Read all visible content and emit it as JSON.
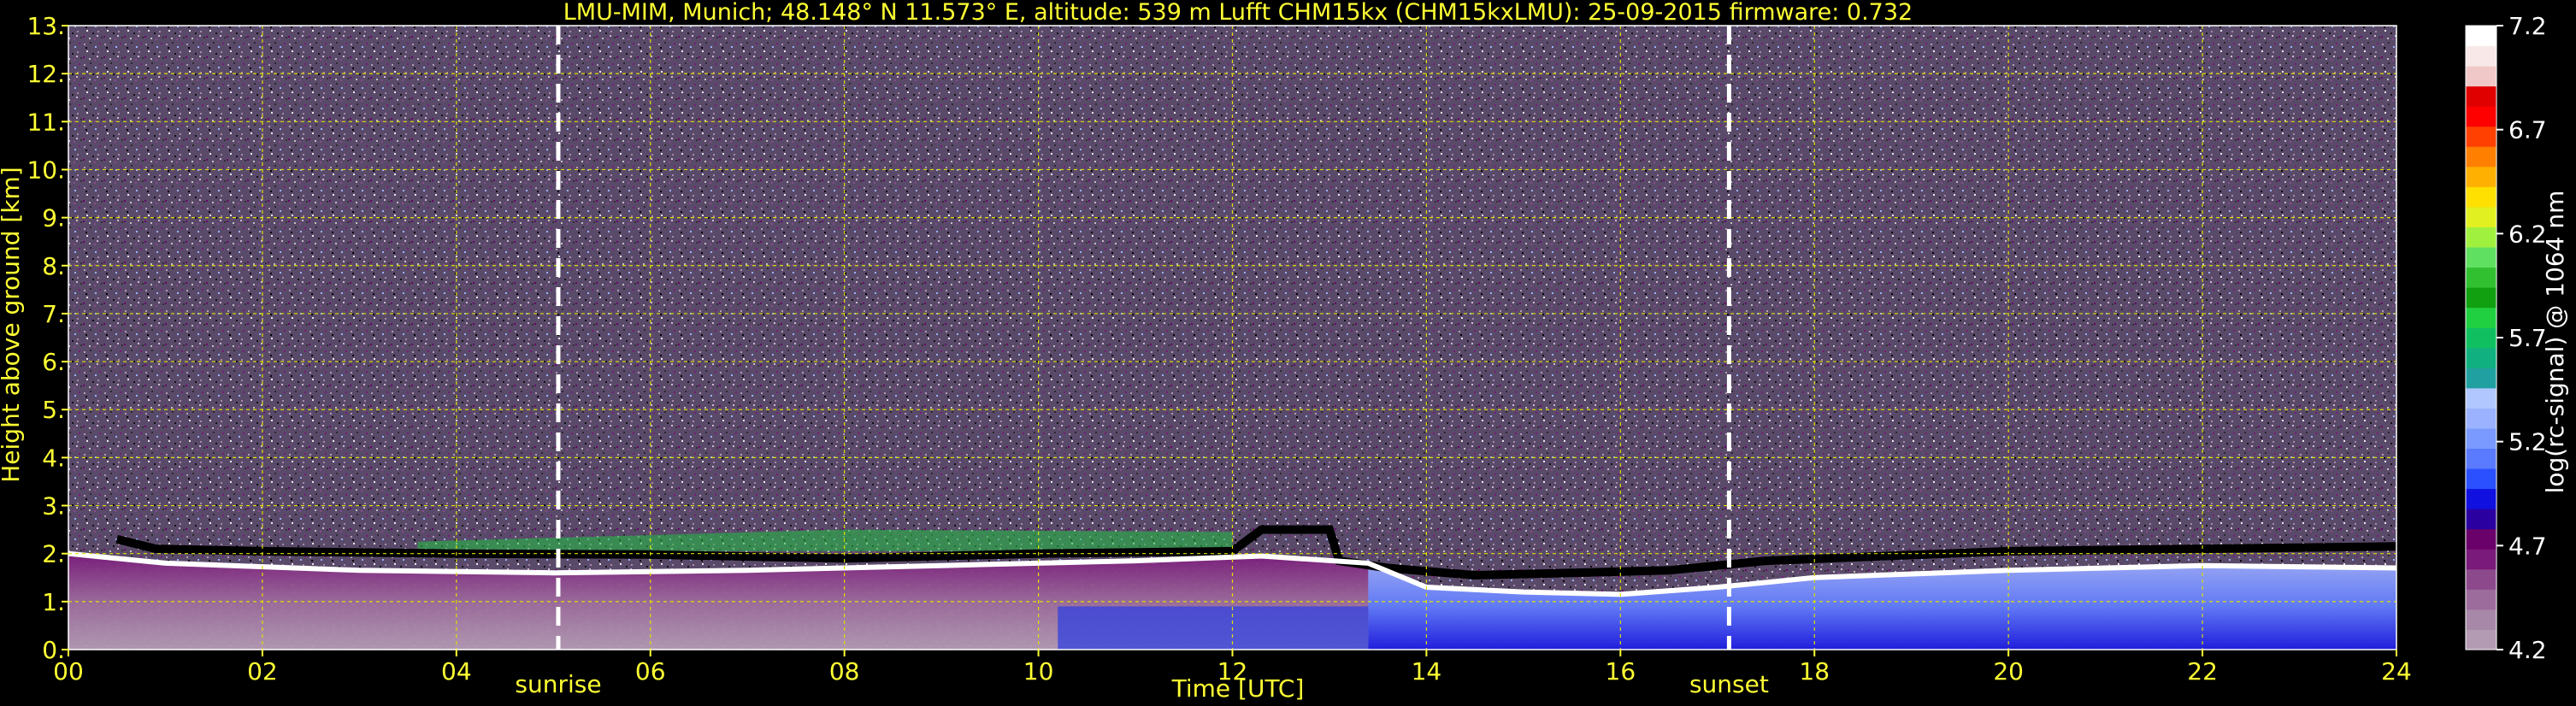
{
  "chart_data": {
    "type": "heatmap",
    "title": "LMU-MIM, Munich; 48.148° N 11.573° E, altitude: 539 m    Lufft CHM15kx (CHM15kxLMU): 25-09-2015    firmware: 0.732",
    "xlabel": "Time [UTC]",
    "ylabel": "Height above ground [km]",
    "colorbar_label": "log(rc-signal) @ 1064 nm",
    "xlim": [
      0,
      24
    ],
    "ylim": [
      0,
      13
    ],
    "x_ticks": [
      0,
      2,
      4,
      6,
      8,
      10,
      12,
      14,
      16,
      18,
      20,
      22,
      24
    ],
    "x_tick_labels": [
      "00",
      "02",
      "04",
      "06",
      "08",
      "10",
      "12",
      "14",
      "16",
      "18",
      "20",
      "22",
      "24"
    ],
    "y_ticks": [
      0,
      1,
      2,
      3,
      4,
      5,
      6,
      7,
      8,
      9,
      10,
      11,
      12,
      13
    ],
    "y_tick_labels": [
      "0.",
      "1.",
      "2.",
      "3.",
      "4.",
      "5.",
      "6.",
      "7.",
      "8.",
      "9.",
      "10.",
      "11.",
      "12.",
      "13."
    ],
    "colorbar_range": [
      4.2,
      7.2
    ],
    "colorbar_ticks": [
      4.2,
      4.7,
      5.2,
      5.7,
      6.2,
      6.7,
      7.2
    ],
    "colorbar_tick_labels": [
      "4.2",
      "4.7",
      "5.2",
      "5.7",
      "6.2",
      "6.7",
      "7.2"
    ],
    "colorbar_colors": [
      "#b49bb4",
      "#a888a8",
      "#9c6c9c",
      "#8c4a8c",
      "#7a1a7a",
      "#6a006a",
      "#2a00a0",
      "#1010e0",
      "#2a50ff",
      "#5a7aff",
      "#7a9aff",
      "#9ab2ff",
      "#b0c8ff",
      "#20a0a0",
      "#10b080",
      "#10c060",
      "#20d040",
      "#10a010",
      "#30c030",
      "#60e060",
      "#a0f040",
      "#e0f020",
      "#ffe000",
      "#ffb000",
      "#ff8000",
      "#ff4000",
      "#ff0000",
      "#e00000",
      "#f0c8c8",
      "#f8e8e8",
      "#ffffff"
    ],
    "grid": true,
    "grid_color": "#e0e000",
    "markers": [
      {
        "label": "sunrise",
        "x": 5.05
      },
      {
        "label": "sunset",
        "x": 17.12
      }
    ],
    "cloud_top_line": [
      [
        0.5,
        2.3
      ],
      [
        0.9,
        2.1
      ],
      [
        2,
        2.05
      ],
      [
        4,
        2.0
      ],
      [
        6,
        1.98
      ],
      [
        8,
        1.9
      ],
      [
        10,
        2.0
      ],
      [
        12,
        2.05
      ],
      [
        12.3,
        2.5
      ],
      [
        13.0,
        2.5
      ],
      [
        13.1,
        1.85
      ],
      [
        13.6,
        1.7
      ],
      [
        14.5,
        1.55
      ],
      [
        15.5,
        1.6
      ],
      [
        16.5,
        1.65
      ],
      [
        17.5,
        1.85
      ],
      [
        20,
        2.05
      ],
      [
        24,
        2.15
      ]
    ],
    "mixing_layer_line": [
      [
        0,
        2.0
      ],
      [
        1,
        1.8
      ],
      [
        3,
        1.65
      ],
      [
        5,
        1.6
      ],
      [
        7,
        1.65
      ],
      [
        9,
        1.75
      ],
      [
        11,
        1.85
      ],
      [
        12.3,
        1.95
      ],
      [
        13.4,
        1.8
      ],
      [
        14,
        1.3
      ],
      [
        15,
        1.2
      ],
      [
        16,
        1.15
      ],
      [
        17,
        1.3
      ],
      [
        18,
        1.5
      ],
      [
        20,
        1.65
      ],
      [
        22,
        1.75
      ],
      [
        24,
        1.7
      ]
    ]
  }
}
